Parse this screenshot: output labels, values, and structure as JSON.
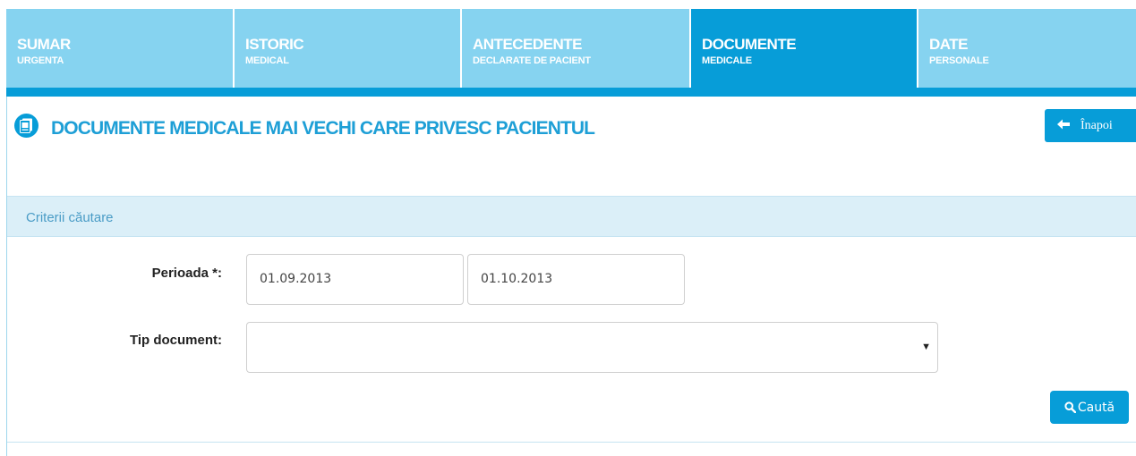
{
  "tabs": [
    {
      "title": "SUMAR",
      "subtitle": "URGENTA",
      "active": false
    },
    {
      "title": "ISTORIC",
      "subtitle": "MEDICAL",
      "active": false
    },
    {
      "title": "ANTECEDENTE",
      "subtitle": "DECLARATE DE PACIENT",
      "active": false
    },
    {
      "title": "DOCUMENTE",
      "subtitle": "MEDICALE",
      "active": true
    },
    {
      "title": "DATE",
      "subtitle": "PERSONALE",
      "active": false
    }
  ],
  "page": {
    "title": "DOCUMENTE MEDICALE MAI VECHI CARE PRIVESC PACIENTUL",
    "icon": "document-icon",
    "back_label": "Înapoi"
  },
  "criteria": {
    "heading": "Criterii căutare",
    "period_label": "Perioada *:",
    "period_from": "01.09.2013",
    "period_to": "01.10.2013",
    "doc_type_label": "Tip document:",
    "doc_type_value": "",
    "search_label": "Caută"
  },
  "colors": {
    "tab_inactive": "#86d3f0",
    "tab_active": "#079dd8",
    "accent": "#079dd8",
    "criteria_bg": "#dbeff8"
  }
}
